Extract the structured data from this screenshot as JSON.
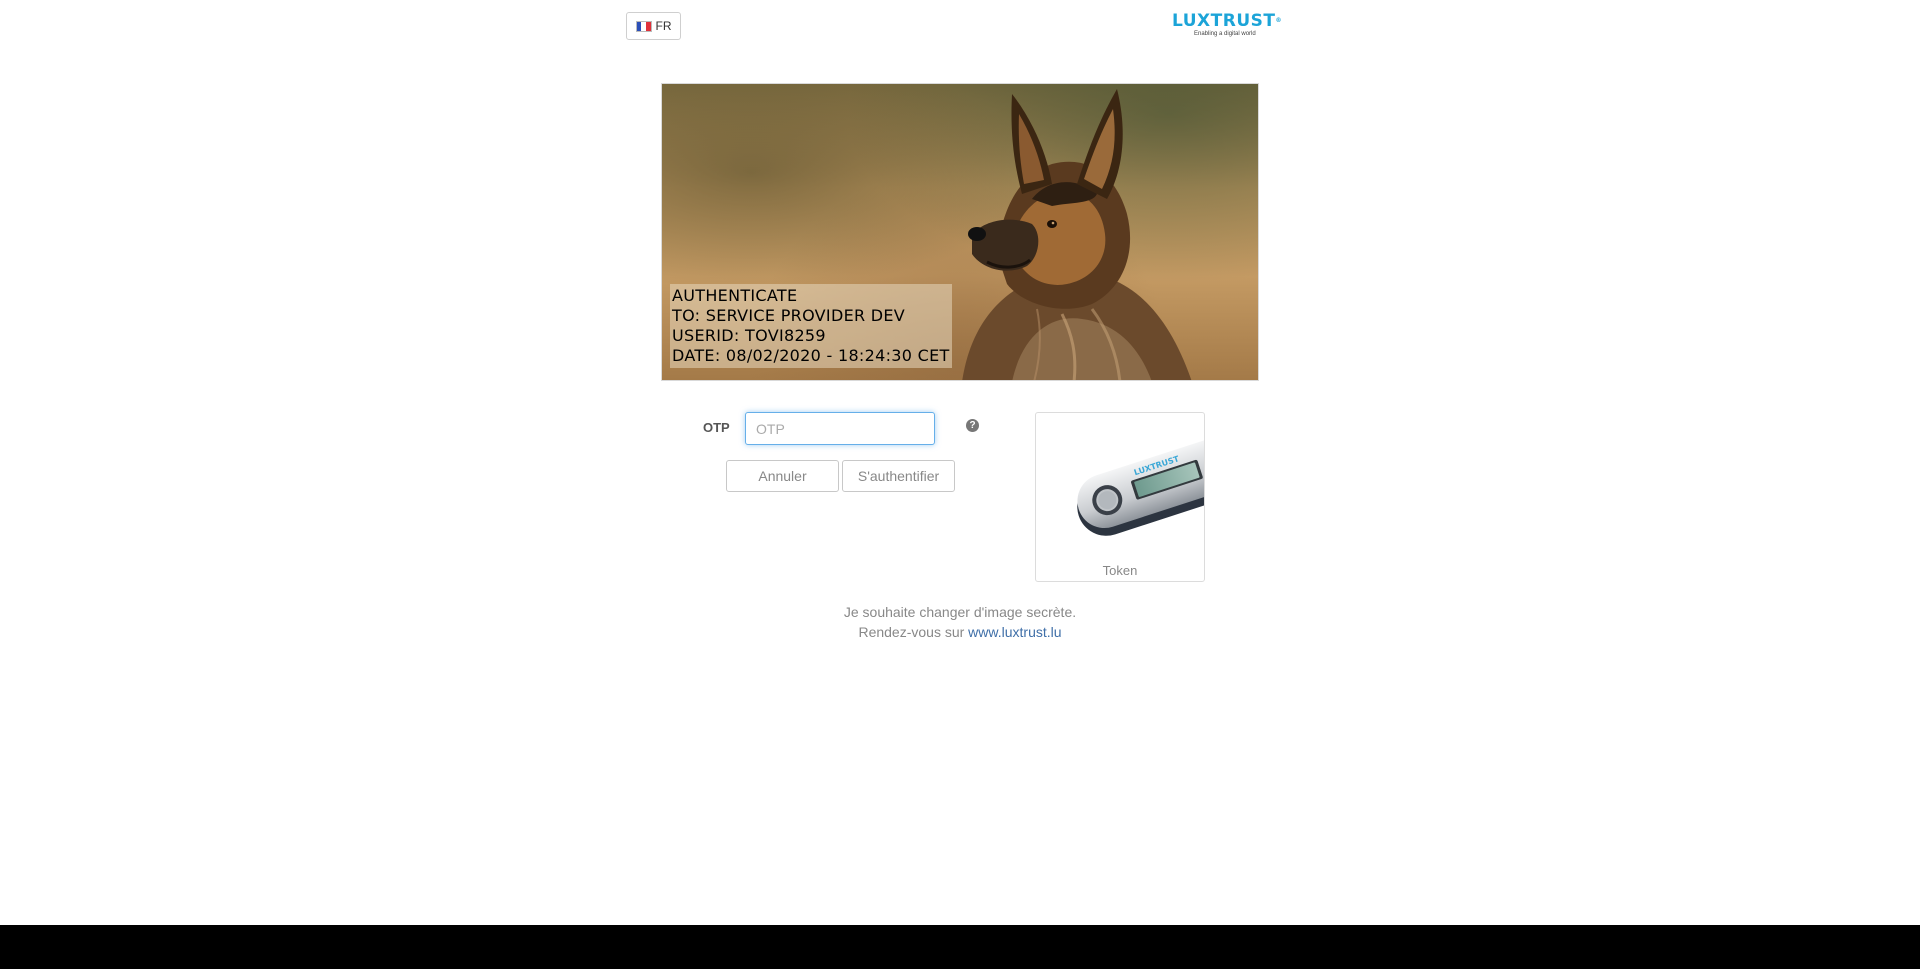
{
  "header": {
    "language": "FR",
    "logo": {
      "brand": "LUXTRUST",
      "tagline": "Enabling a digital world"
    }
  },
  "secret_image": {
    "lines": [
      "AUTHENTICATE",
      "TO: SERVICE PROVIDER DEV",
      "USERID: TOVI8259",
      "DATE: 08/02/2020 - 18:24:30 CET"
    ]
  },
  "form": {
    "otp_label": "OTP",
    "otp_placeholder": "OTP",
    "otp_value": "",
    "help_icon": "?",
    "cancel_label": "Annuler",
    "authenticate_label": "S'authentifier"
  },
  "token": {
    "label": "Token",
    "device_brand": "LUXTRUST"
  },
  "footer": {
    "change_image_text": "Je souhaite changer d'image secrète.",
    "visit_text": "Rendez-vous sur",
    "link_text": "www.luxtrust.lu"
  },
  "colors": {
    "brand": "#1ca4d8",
    "link": "#3f6fa8",
    "input_focus": "#66afe9"
  }
}
